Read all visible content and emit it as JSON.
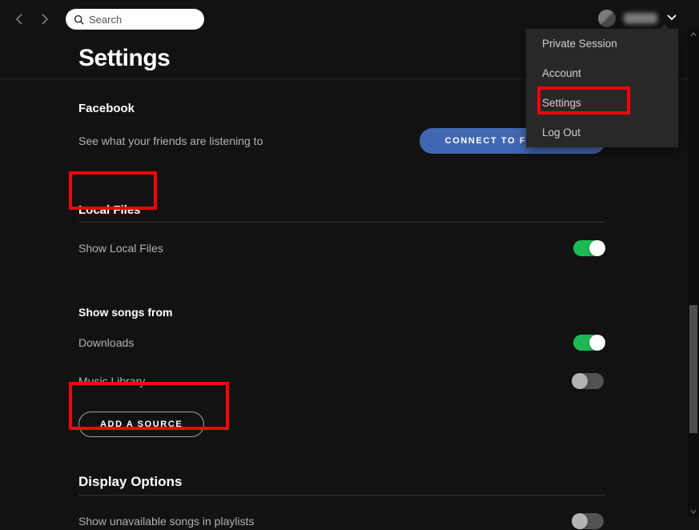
{
  "topbar": {
    "search_placeholder": "Search"
  },
  "dropdown": {
    "items": [
      {
        "label": "Private Session"
      },
      {
        "label": "Account"
      },
      {
        "label": "Settings"
      },
      {
        "label": "Log Out"
      }
    ]
  },
  "page": {
    "title": "Settings"
  },
  "facebook": {
    "heading": "Facebook",
    "description": "See what your friends are listening to",
    "button": "CONNECT TO FACEBOOK"
  },
  "local_files": {
    "heading": "Local Files",
    "show_local_label": "Show Local Files",
    "show_local_on": true,
    "show_songs_heading": "Show songs from",
    "sources": [
      {
        "label": "Downloads",
        "on": true
      },
      {
        "label": "Music Library",
        "on": false
      }
    ],
    "add_source": "ADD A SOURCE"
  },
  "display_options": {
    "heading": "Display Options",
    "unavailable_label": "Show unavailable songs in playlists",
    "unavailable_on": false
  }
}
